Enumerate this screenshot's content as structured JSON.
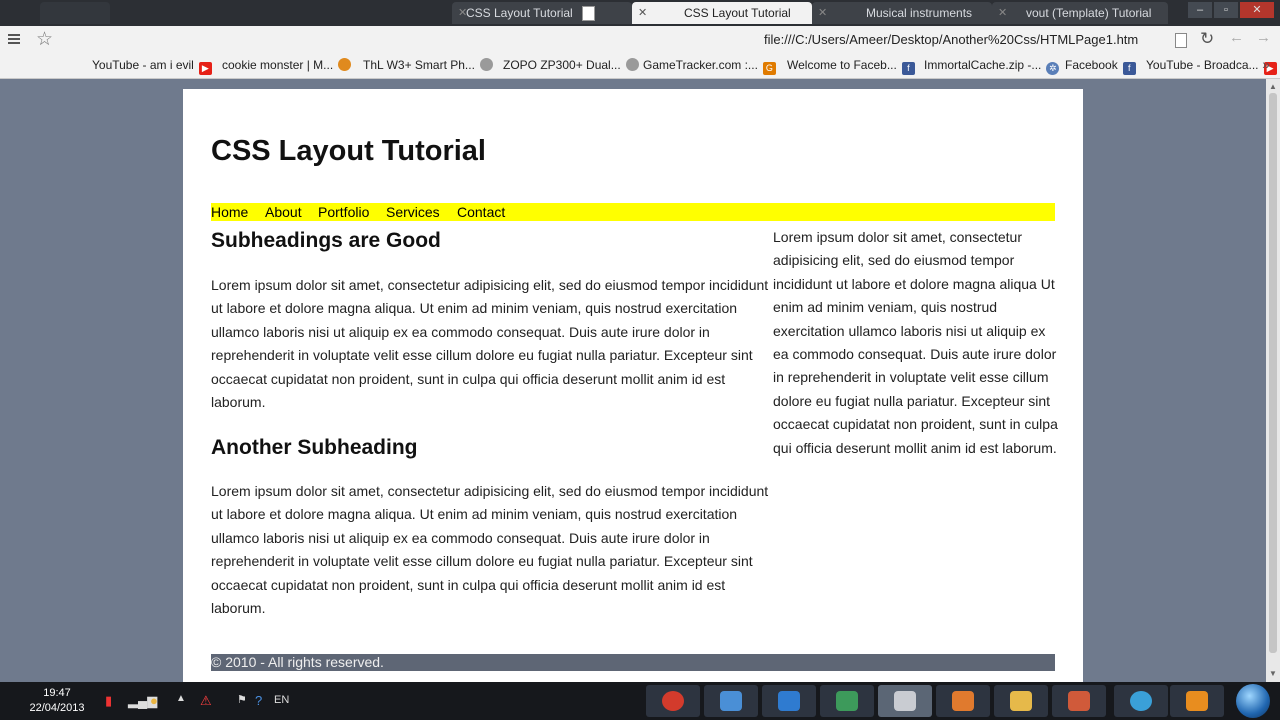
{
  "browser": {
    "tabs": [
      {
        "label": "",
        "active": false
      },
      {
        "label": "CSS Layout Tutorial",
        "active": false
      },
      {
        "label": "CSS Layout Tutorial",
        "active": true
      },
      {
        "label": "Musical instruments",
        "active": false
      },
      {
        "label": "vout (Template) Tutorial",
        "active": false
      }
    ],
    "url": "file:///C:/Users/Ameer/Desktop/Another%20Css/HTMLPage1.htm",
    "bookmarks": [
      {
        "label": "YouTube - am i evil",
        "icon": "youtube-icon",
        "color": "#e62117"
      },
      {
        "label": "cookie monster | M...",
        "icon": "pumpkin-icon",
        "color": "#e08a1e"
      },
      {
        "label": "ThL W3+ Smart Ph...",
        "icon": "cat-icon",
        "color": "#777777"
      },
      {
        "label": "ZOPO ZP300+ Dual...",
        "icon": "cat-icon",
        "color": "#777777"
      },
      {
        "label": "GameTracker.com :...",
        "icon": "gametracker-icon",
        "color": "#e07b00"
      },
      {
        "label": "Welcome to Faceb...",
        "icon": "facebook-icon",
        "color": "#3b5998"
      },
      {
        "label": "ImmortalCache.zip -...",
        "icon": "gear-icon",
        "color": "#5a7fb8"
      },
      {
        "label": "Facebook",
        "icon": "facebook-icon",
        "color": "#3b5998"
      },
      {
        "label": "YouTube - Broadca...",
        "icon": "youtube-icon",
        "color": "#e62117"
      }
    ]
  },
  "page": {
    "title": "CSS Layout Tutorial",
    "nav": [
      "Home",
      "About",
      "Portfolio",
      "Services",
      "Contact"
    ],
    "section1": {
      "heading": "Subheadings are Good",
      "body": "Lorem ipsum dolor sit amet, consectetur adipisicing elit, sed do eiusmod tempor incididunt ut labore et dolore magna aliqua. Ut enim ad minim veniam, quis nostrud exercitation ullamco laboris nisi ut aliquip ex ea commodo consequat. Duis aute irure dolor in reprehenderit in voluptate velit esse cillum dolore eu fugiat nulla pariatur. Excepteur sint occaecat cupidatat non proident, sunt in culpa qui officia deserunt mollit anim id est laborum."
    },
    "section2": {
      "heading": "Another Subheading",
      "body": "Lorem ipsum dolor sit amet, consectetur adipisicing elit, sed do eiusmod tempor incididunt ut labore et dolore magna aliqua. Ut enim ad minim veniam, quis nostrud exercitation ullamco laboris nisi ut aliquip ex ea commodo consequat. Duis aute irure dolor in reprehenderit in voluptate velit esse cillum dolore eu fugiat nulla pariatur. Excepteur sint occaecat cupidatat non proident, sunt in culpa qui officia deserunt mollit anim id est laborum."
    },
    "sidebar": "Lorem ipsum dolor sit amet, consectetur adipisicing elit, sed do eiusmod tempor incididunt ut labore et dolore magna aliqua Ut enim ad minim veniam, quis nostrud exercitation ullamco laboris nisi ut aliquip ex ea commodo consequat. Duis aute irure dolor in reprehenderit in voluptate velit esse cillum dolore eu fugiat nulla pariatur. Excepteur sint occaecat cupidatat non proident, sunt in culpa qui officia deserunt mollit anim id est laborum.",
    "footer": "© 2010 - All rights reserved.",
    "colors": {
      "nav_bg": "#ffff00",
      "footer_bg": "#5e6675",
      "page_bg": "#6f7a8d"
    }
  },
  "taskbar": {
    "time": "19:47",
    "date": "22/04/2013",
    "language": "EN",
    "apps": [
      {
        "name": "chrome-app",
        "color": "#d33b2c"
      },
      {
        "name": "pen-app",
        "color": "#4a8fd6"
      },
      {
        "name": "screen-app",
        "color": "#2f7bd0"
      },
      {
        "name": "people-app",
        "color": "#3d9a5b"
      },
      {
        "name": "document-app",
        "color": "#c9ccd2"
      },
      {
        "name": "dreamweaver-app",
        "color": "#e07a2e"
      },
      {
        "name": "folder-app",
        "color": "#e6b94a"
      },
      {
        "name": "paint-app",
        "color": "#d05a3a"
      },
      {
        "name": "hp-app",
        "color": "#3aa0d8"
      },
      {
        "name": "media-app",
        "color": "#e88d1f"
      }
    ]
  }
}
